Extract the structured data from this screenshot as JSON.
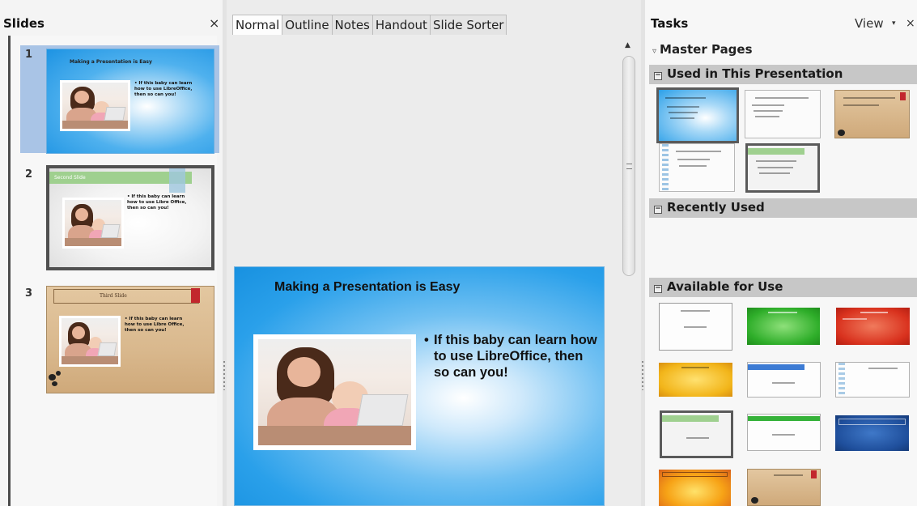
{
  "slides_pane": {
    "title": "Slides",
    "close_glyph": "×",
    "slides": [
      {
        "number": "1",
        "title": "Making a Presentation is Easy",
        "bullet": "• If this baby can learn how to use LibreOffice, then so can you!",
        "theme": "blue",
        "selected": true
      },
      {
        "number": "2",
        "title": "Second Slide",
        "bullet": "• If this baby can learn how to use Libre Office, then so can you!",
        "theme": "gray-green",
        "selected": false
      },
      {
        "number": "3",
        "title": "Third Slide",
        "bullet": "• If this baby can learn how to use Libre Office, then so can you!",
        "theme": "tan",
        "selected": false
      }
    ]
  },
  "view_tabs": [
    "Normal",
    "Outline",
    "Notes",
    "Handout",
    "Slide Sorter"
  ],
  "active_tab": "Normal",
  "main_slide": {
    "title": "Making a Presentation is Easy",
    "bullet_dot": "•",
    "bullet": "If this baby can learn how to use LibreOffice, then so can you!"
  },
  "scrollbar": {
    "up_glyph": "▲"
  },
  "tasks_pane": {
    "title": "Tasks",
    "view_label": "View",
    "view_arrow": "▾",
    "close_glyph": "×",
    "master_pages_label": "Master Pages",
    "master_pages_glyph": "▿",
    "sections": {
      "used": "Used in This Presentation",
      "recent": "Recently Used",
      "available": "Available for Use"
    },
    "collapse_glyph": "−"
  },
  "colors": {
    "accent_blue": "#1f97e4",
    "selection": "#a9c4e6",
    "section_bar": "#c7c7c7",
    "brand_red": "#c2272d"
  },
  "icons": [
    "close-icon",
    "up-arrow-icon",
    "dropdown-arrow-icon",
    "collapse-icon",
    "expand-triangle-icon"
  ]
}
